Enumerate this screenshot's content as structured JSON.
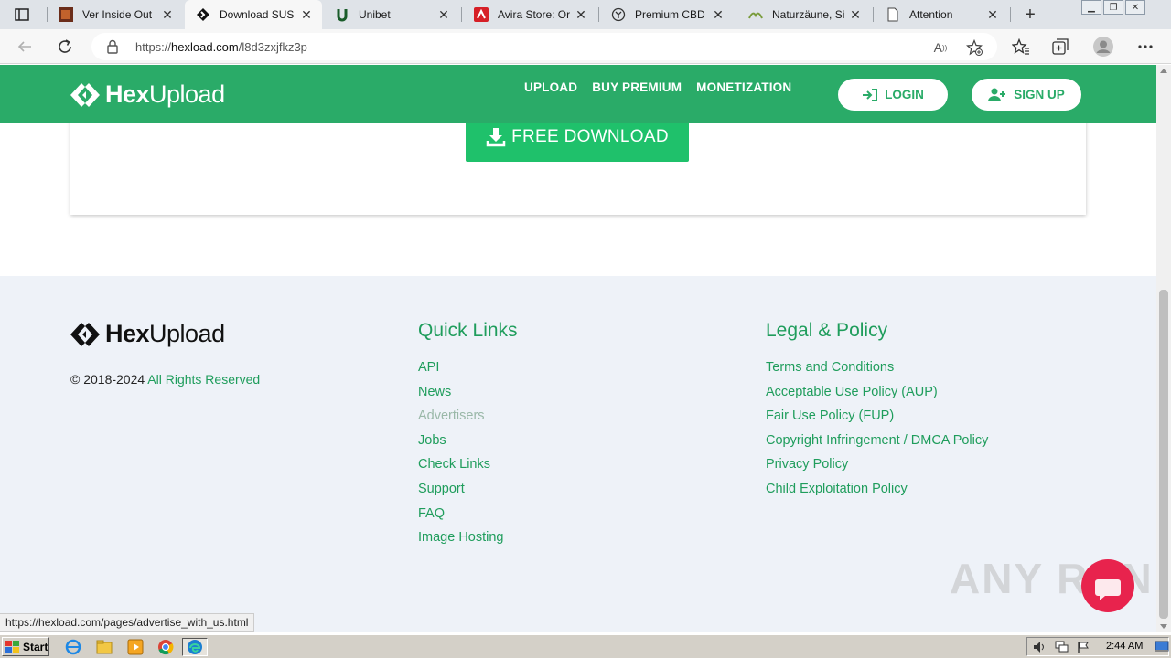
{
  "browser": {
    "tabs": [
      {
        "title": "Ver Inside Out",
        "icon": "movie-favicon",
        "active": false
      },
      {
        "title": "Download SUS",
        "icon": "hexupload-favicon",
        "active": true
      },
      {
        "title": "Unibet",
        "icon": "unibet-favicon",
        "active": false
      },
      {
        "title": "Avira Store: Or",
        "icon": "avira-favicon",
        "active": false
      },
      {
        "title": "Premium CBD",
        "icon": "cbd-favicon",
        "active": false
      },
      {
        "title": "Naturzäune, Si",
        "icon": "fence-favicon",
        "active": false
      },
      {
        "title": "Attention",
        "icon": "page-favicon",
        "active": false
      }
    ],
    "url_prefix": "https://",
    "url_host": "hexload.com",
    "url_path": "/l8d3zxjfkz3p",
    "read_aloud_label": "A",
    "status_url": "https://hexload.com/pages/advertise_with_us.html"
  },
  "site": {
    "brand_hex": "Hex",
    "brand_upload": "Upload",
    "nav": [
      "UPLOAD",
      "BUY PREMIUM",
      "MONETIZATION"
    ],
    "login_label": "LOGIN",
    "signup_label": "SIGN UP",
    "download_label": "FREE DOWNLOAD",
    "accent": "#2aab68"
  },
  "footer": {
    "copyright_prefix": "© 2018-2024",
    "rights": "All Rights Reserved",
    "quick_links_title": "Quick Links",
    "quick_links": [
      "API",
      "News",
      "Advertisers",
      "Jobs",
      "Check Links",
      "Support",
      "FAQ",
      "Image Hosting"
    ],
    "legal_title": "Legal & Policy",
    "legal_links": [
      "Terms and Conditions",
      "Acceptable Use Policy (AUP)",
      "Fair Use Policy (FUP)",
      "Copyright Infringement / DMCA Policy",
      "Privacy Policy",
      "Child Exploitation Policy"
    ]
  },
  "watermark": "ANY RUN",
  "taskbar": {
    "start_label": "Start",
    "clock": "2:44 AM"
  }
}
